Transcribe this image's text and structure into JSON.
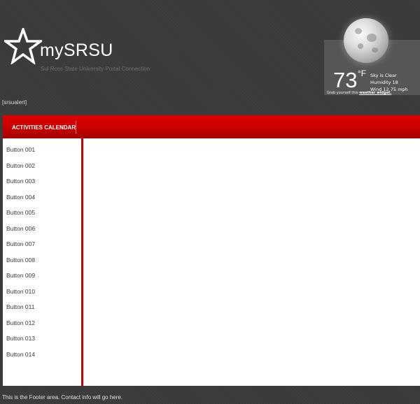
{
  "header": {
    "title": "mySRSU",
    "tagline": "Sul Ross State University Portal Connection"
  },
  "weather": {
    "temperature": "73",
    "unit": "°F",
    "condition": "Sky is Clear",
    "humidity": "Humidity 18",
    "wind": "Wind 12.75 mph",
    "grab_text": "Grab yourself this ",
    "grab_link": "weather widget."
  },
  "alert": "[srsualert]",
  "nav": {
    "items": [
      "ACTIVITIES CALENDAR"
    ]
  },
  "sidebar": {
    "buttons": [
      "Button 001",
      "Button 002",
      "Button 003",
      "Button 004",
      "Button 005",
      "Button 006",
      "Button 007",
      "Button 008",
      "Button 009",
      "Button 010",
      "Button 011",
      "Button 012",
      "Button 013",
      "Button 014"
    ]
  },
  "footer": "This is the Footer area. Contact info will go here.",
  "colors": {
    "accent": "#cc0000",
    "background": "#3a3a3a"
  }
}
